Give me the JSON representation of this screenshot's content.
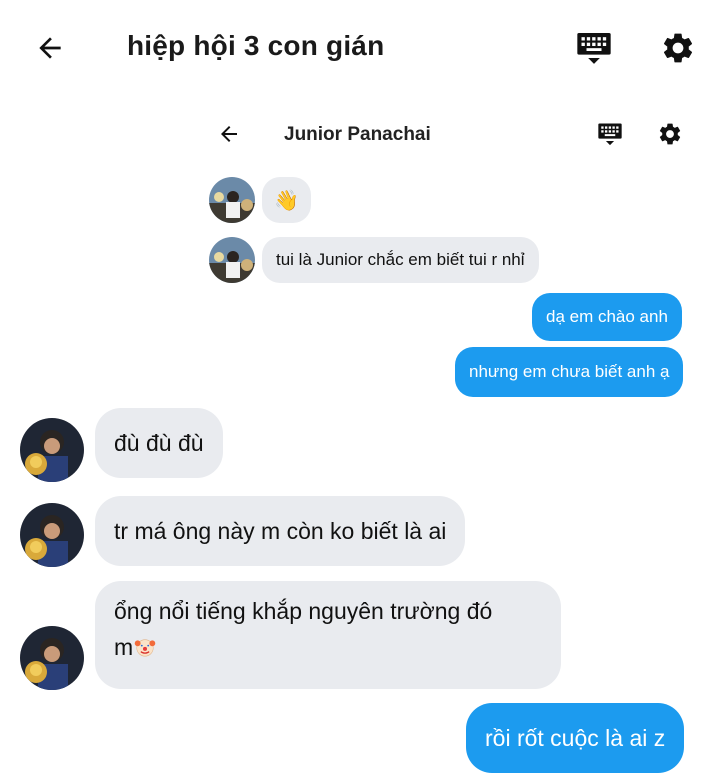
{
  "header": {
    "title": "hiệp hội 3 con gián",
    "back_icon": "arrow-left-icon",
    "keyboard_icon": "keyboard-icon",
    "settings_icon": "gear-icon"
  },
  "embedded_chat": {
    "title": "Junior Panachai",
    "messages": [
      {
        "from": "Junior Panachai",
        "text": "👋"
      },
      {
        "from": "Junior Panachai",
        "text": "tui là Junior chắc em biết tui r nhỉ"
      },
      {
        "from": "me",
        "text": "dạ em chào anh"
      },
      {
        "from": "me",
        "text": "nhưng em chưa biết anh ạ"
      }
    ]
  },
  "messages": [
    {
      "from": "other",
      "text": "đù đù đù"
    },
    {
      "from": "other",
      "text": "tr má ông này m còn ko biết là ai"
    },
    {
      "from": "other",
      "text_line1": "ổng nổi tiếng khắp nguyên trường đó",
      "text_line2": "m",
      "emoji": "clown-face-emoji"
    },
    {
      "from": "me",
      "text": "rồi rốt cuộc là ai z"
    }
  ],
  "colors": {
    "incoming_bubble": "#e9ebef",
    "outgoing_bubble": "#1c9bef",
    "background": "#ffffff"
  }
}
